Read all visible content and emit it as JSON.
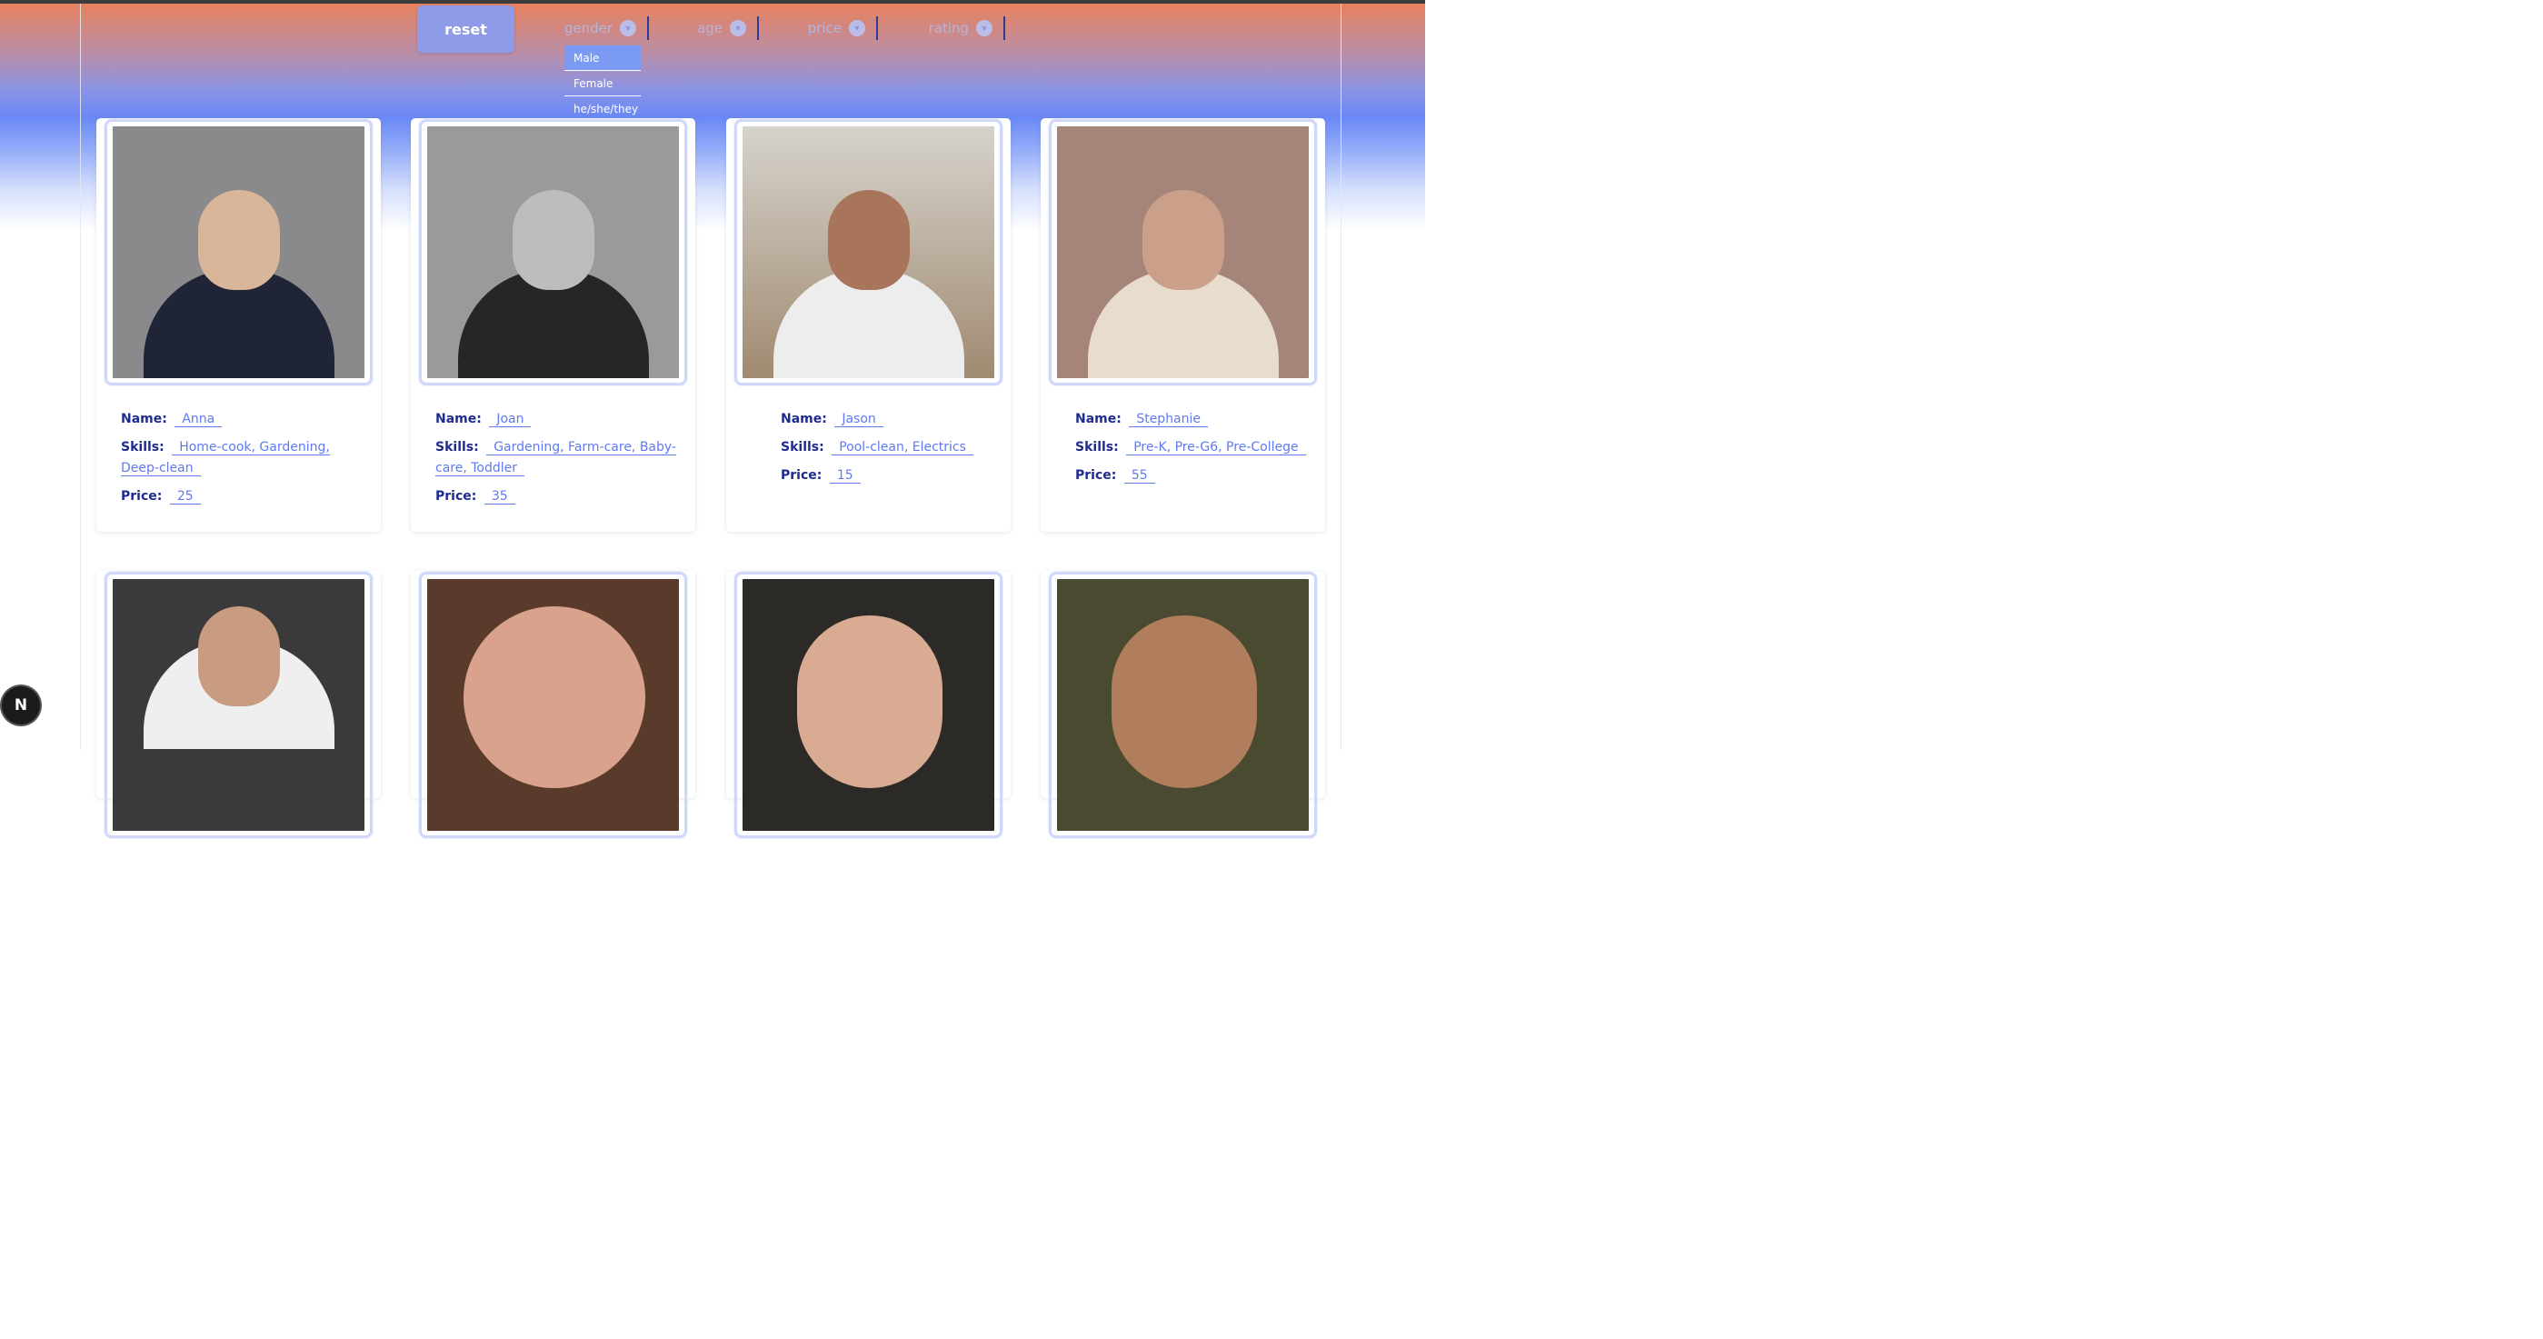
{
  "toolbar": {
    "reset_label": "reset",
    "filters": [
      {
        "label": "gender",
        "icon": "chevron-down-icon"
      },
      {
        "label": "age",
        "icon": "chevron-down-icon"
      },
      {
        "label": "price",
        "icon": "chevron-down-icon"
      },
      {
        "label": "rating",
        "icon": "chevron-down-icon"
      }
    ],
    "gender_options": [
      "Male",
      "Female",
      "he/she/they"
    ]
  },
  "field_labels": {
    "name": "Name:",
    "skills": "Skills:",
    "price": "Price:"
  },
  "cards": [
    {
      "name": "Anna",
      "skills": "Home-cook, Gardening, Deep-clean",
      "price": "25"
    },
    {
      "name": "Joan",
      "skills": "Gardening, Farm-care, Baby-care, Toddler",
      "price": "35"
    },
    {
      "name": "Jason",
      "skills": "Pool-clean, Electrics",
      "price": "15"
    },
    {
      "name": "Stephanie",
      "skills": "Pre-K, Pre-G6, Pre-College",
      "price": "55"
    }
  ],
  "badge": {
    "label": "N"
  },
  "colors": {
    "accent": "#5f79f0",
    "label_text": "#1e2b8f",
    "reset_bg": "#8d9be8"
  }
}
